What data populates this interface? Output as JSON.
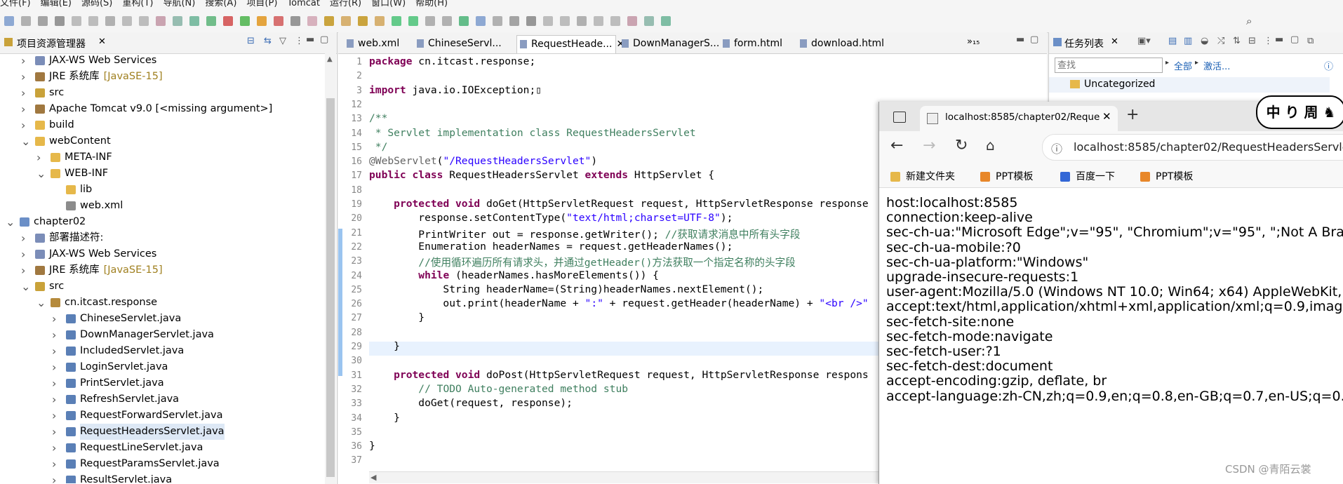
{
  "menubar": {
    "items": [
      "文件(F)",
      "编辑(E)",
      "源码(S)",
      "重构(T)",
      "导航(N)",
      "搜索(A)",
      "项目(P)",
      "Tomcat",
      "运行(R)",
      "窗口(W)",
      "帮助(H)"
    ]
  },
  "left_panel": {
    "title": "项目资源管理器",
    "tree": [
      {
        "label": "JAX-WS Web Services",
        "extra": "",
        "indent": 1,
        "icon": "webservice-icon",
        "twisty": ">"
      },
      {
        "label": "JRE 系统库",
        "extra": "[JavaSE-15]",
        "indent": 1,
        "icon": "library-icon",
        "twisty": ">"
      },
      {
        "label": "src",
        "extra": "",
        "indent": 1,
        "icon": "package-folder-icon",
        "twisty": ">"
      },
      {
        "label": "Apache Tomcat v9.0 [<missing argument>]",
        "extra": "",
        "indent": 1,
        "icon": "library-icon",
        "twisty": ">"
      },
      {
        "label": "build",
        "extra": "",
        "indent": 1,
        "icon": "folder-icon",
        "twisty": ">"
      },
      {
        "label": "webContent",
        "extra": "",
        "indent": 1,
        "icon": "folder-open-icon",
        "twisty": "v"
      },
      {
        "label": "META-INF",
        "extra": "",
        "indent": 2,
        "icon": "folder-icon",
        "twisty": ">"
      },
      {
        "label": "WEB-INF",
        "extra": "",
        "indent": 2,
        "icon": "folder-open-icon",
        "twisty": "v"
      },
      {
        "label": "lib",
        "extra": "",
        "indent": 3,
        "icon": "folder-icon",
        "twisty": ""
      },
      {
        "label": "web.xml",
        "extra": "",
        "indent": 3,
        "icon": "xml-file-icon",
        "twisty": ""
      },
      {
        "label": "chapter02",
        "extra": "",
        "indent": 0,
        "icon": "project-icon",
        "twisty": "v"
      },
      {
        "label": "部署描述符:",
        "extra": "",
        "indent": 1,
        "icon": "descriptor-icon",
        "twisty": ">"
      },
      {
        "label": "JAX-WS Web Services",
        "extra": "",
        "indent": 1,
        "icon": "webservice-icon",
        "twisty": ">"
      },
      {
        "label": "JRE 系统库",
        "extra": "[JavaSE-15]",
        "indent": 1,
        "icon": "library-icon",
        "twisty": ">"
      },
      {
        "label": "src",
        "extra": "",
        "indent": 1,
        "icon": "package-folder-icon",
        "twisty": "v"
      },
      {
        "label": "cn.itcast.response",
        "extra": "",
        "indent": 2,
        "icon": "package-icon",
        "twisty": "v"
      },
      {
        "label": "ChineseServlet.java",
        "extra": "",
        "indent": 3,
        "icon": "java-file-icon",
        "twisty": ">"
      },
      {
        "label": "DownManagerServlet.java",
        "extra": "",
        "indent": 3,
        "icon": "java-file-icon",
        "twisty": ">"
      },
      {
        "label": "IncludedServlet.java",
        "extra": "",
        "indent": 3,
        "icon": "java-file-icon",
        "twisty": ">"
      },
      {
        "label": "LoginServlet.java",
        "extra": "",
        "indent": 3,
        "icon": "java-file-icon",
        "twisty": ">"
      },
      {
        "label": "PrintServlet.java",
        "extra": "",
        "indent": 3,
        "icon": "java-file-icon",
        "twisty": ">"
      },
      {
        "label": "RefreshServlet.java",
        "extra": "",
        "indent": 3,
        "icon": "java-file-icon",
        "twisty": ">"
      },
      {
        "label": "RequestForwardServlet.java",
        "extra": "",
        "indent": 3,
        "icon": "java-file-icon",
        "twisty": ">"
      },
      {
        "label": "RequestHeadersServlet.java",
        "extra": "",
        "indent": 3,
        "icon": "java-file-icon",
        "twisty": ">",
        "selected": true
      },
      {
        "label": "RequestLineServlet.java",
        "extra": "",
        "indent": 3,
        "icon": "java-file-icon",
        "twisty": ">"
      },
      {
        "label": "RequestParamsServlet.java",
        "extra": "",
        "indent": 3,
        "icon": "java-file-icon",
        "twisty": ">"
      },
      {
        "label": "ResultServlet.java",
        "extra": "",
        "indent": 3,
        "icon": "java-file-icon",
        "twisty": ">"
      }
    ]
  },
  "editor": {
    "tabs": [
      {
        "label": "web.xml",
        "active": false
      },
      {
        "label": "ChineseServl...",
        "active": false
      },
      {
        "label": "RequestHeade...",
        "active": true
      },
      {
        "label": "DownManagerS...",
        "active": false
      },
      {
        "label": "form.html",
        "active": false
      },
      {
        "label": "download.html",
        "active": false
      }
    ],
    "overflow_label": "»₁₅",
    "lines": [
      {
        "num": "1",
        "html": "<span class=\"kw\">package</span> cn.itcast.response;"
      },
      {
        "num": "2",
        "html": ""
      },
      {
        "num": "3",
        "html": "<span class=\"kw\">import</span> java.io.IOException;▯"
      },
      {
        "num": "12",
        "html": ""
      },
      {
        "num": "13",
        "html": "<span class=\"cm\">/**</span>"
      },
      {
        "num": "14",
        "html": "<span class=\"cm\"> * Servlet implementation class RequestHeadersServlet</span>"
      },
      {
        "num": "15",
        "html": "<span class=\"cm\"> */</span>"
      },
      {
        "num": "16",
        "html": "<span class=\"an\">@WebServlet</span>(<span class=\"st\">\"/RequestHeadersServlet\"</span>)"
      },
      {
        "num": "17",
        "html": "<span class=\"kw\">public class</span> RequestHeadersServlet <span class=\"kw\">extends</span> HttpServlet {"
      },
      {
        "num": "18",
        "html": ""
      },
      {
        "num": "19",
        "html": "    <span class=\"kw\">protected void</span> doGet(HttpServletRequest request, HttpServletResponse response"
      },
      {
        "num": "20",
        "html": "        response.setContentType(<span class=\"st\">\"text/html;charset=UTF-8\"</span>);"
      },
      {
        "num": "21",
        "html": "        PrintWriter out = response.getWriter(); <span class=\"cm\">//获取请求消息中所有头字段</span>"
      },
      {
        "num": "22",
        "html": "        Enumeration headerNames = request.getHeaderNames();"
      },
      {
        "num": "23",
        "html": "        <span class=\"cm\">//使用循环遍历所有请求头，并通过getHeader()方法获取一个指定名称的头字段</span>"
      },
      {
        "num": "24",
        "html": "        <span class=\"kw\">while</span> (headerNames.hasMoreElements()) {"
      },
      {
        "num": "25",
        "html": "            String headerName=(String)headerNames.nextElement();"
      },
      {
        "num": "26",
        "html": "            out.print(headerName + <span class=\"st\">\":\"</span> + request.getHeader(headerName) + <span class=\"st\">\"&lt;br /&gt;\"</span>"
      },
      {
        "num": "27",
        "html": "        }"
      },
      {
        "num": "28",
        "html": ""
      },
      {
        "num": "29",
        "html": "    }"
      },
      {
        "num": "30",
        "html": ""
      },
      {
        "num": "31",
        "html": "    <span class=\"kw\">protected void</span> doPost(HttpServletRequest request, HttpServletResponse respons"
      },
      {
        "num": "32",
        "html": "        <span class=\"cm\">// TODO Auto-generated method stub</span>"
      },
      {
        "num": "33",
        "html": "        doGet(request, response);"
      },
      {
        "num": "34",
        "html": "    }"
      },
      {
        "num": "35",
        "html": ""
      },
      {
        "num": "36",
        "html": "}"
      },
      {
        "num": "37",
        "html": ""
      }
    ]
  },
  "right_panel": {
    "title": "任务列表",
    "search_placeholder": "查找",
    "all_label": "全部",
    "activate_label": "激活...",
    "category": "Uncategorized"
  },
  "browser": {
    "tab_title": "localhost:8585/chapter02/Reque",
    "url": "localhost:8585/chapter02/RequestHeadersServle",
    "bookmarks": [
      "新建文件夹",
      "PPT模板",
      "百度一下",
      "PPT模板"
    ],
    "headers": [
      "host:localhost:8585",
      "connection:keep-alive",
      "sec-ch-ua:\"Microsoft Edge\";v=\"95\", \"Chromium\";v=\"95\", \";Not A Bra",
      "sec-ch-ua-mobile:?0",
      "sec-ch-ua-platform:\"Windows\"",
      "upgrade-insecure-requests:1",
      "user-agent:Mozilla/5.0 (Windows NT 10.0; Win64; x64) AppleWebKit,",
      "accept:text/html,application/xhtml+xml,application/xml;q=0.9,image",
      "sec-fetch-site:none",
      "sec-fetch-mode:navigate",
      "sec-fetch-user:?1",
      "sec-fetch-dest:document",
      "accept-encoding:gzip, deflate, br",
      "accept-language:zh-CN,zh;q=0.9,en;q=0.8,en-GB;q=0.7,en-US;q=0.6"
    ]
  },
  "logo_text": "中 り 周 ♞",
  "watermark": "CSDN @青陌云裳",
  "colors": {
    "keyword": "#7f0055",
    "comment": "#3f7f5f",
    "string": "#2a00ff",
    "selection": "#dde8f5"
  }
}
